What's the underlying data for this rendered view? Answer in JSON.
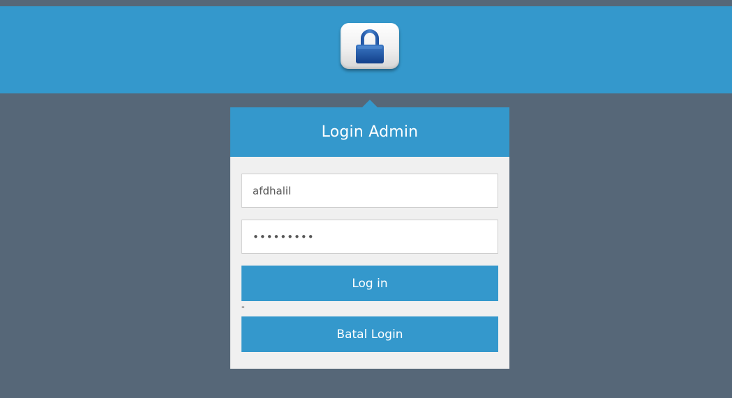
{
  "header": {
    "logo_icon": "padlock-icon"
  },
  "login_card": {
    "title": "Login Admin",
    "username_value": "afdhalil",
    "password_value": "•••••••••",
    "login_button_label": "Log in",
    "separator_text": "-",
    "cancel_button_label": "Batal Login"
  },
  "colors": {
    "background": "#566778",
    "accent": "#3498cc",
    "card_background": "#f0f0f0"
  }
}
